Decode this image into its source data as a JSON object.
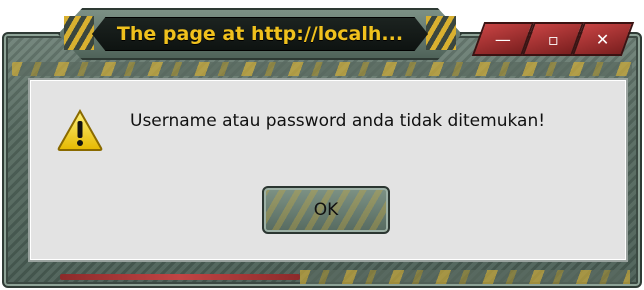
{
  "window": {
    "title": "The page at http://localh...",
    "controls": [
      {
        "name": "minimize",
        "glyph": "—"
      },
      {
        "name": "maximize",
        "glyph": "▫"
      },
      {
        "name": "close",
        "glyph": "✕"
      }
    ]
  },
  "dialog": {
    "icon": "warning-icon",
    "message": "Username atau password anda tidak ditemukan!",
    "ok_label": "OK"
  },
  "colors": {
    "title_text": "#f0c11d",
    "frame": "#55695f",
    "panel": "#e3e3e3",
    "control_red": "#c74343"
  }
}
